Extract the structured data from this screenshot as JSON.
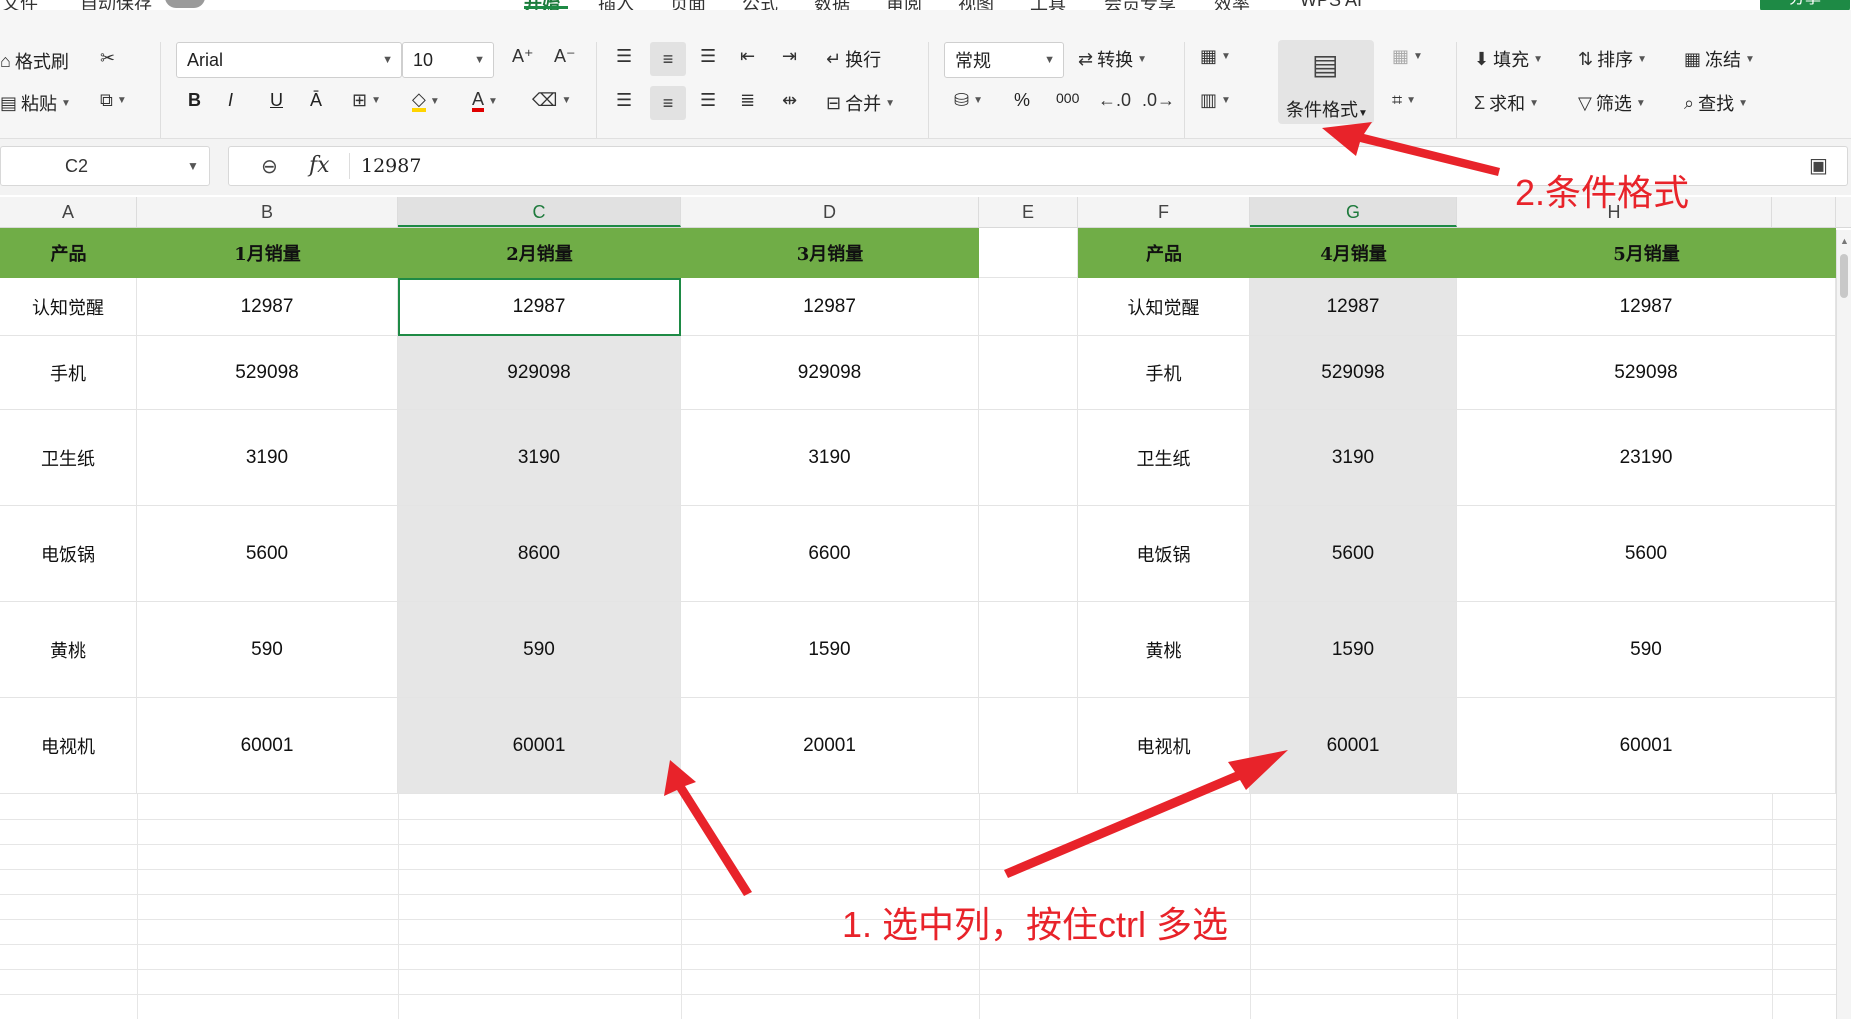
{
  "menu": {
    "items": [
      "文件",
      "自动保存",
      "开始",
      "插入",
      "页面",
      "公式",
      "数据",
      "审阅",
      "视图",
      "工具",
      "会员专享",
      "效率",
      "WPS AI"
    ],
    "active": "开始",
    "share": "分享"
  },
  "ribbon": {
    "format_painter": "格式刷",
    "paste": "粘贴",
    "font_name": "Arial",
    "font_size": "10",
    "bold": "B",
    "italic": "I",
    "underline": "U",
    "strikethrough": "Ā",
    "font_color_letter": "A",
    "wrap": "换行",
    "merge": "合并",
    "number_format": "常规",
    "convert": "转换",
    "percent": "%",
    "thousands": "000",
    "conditional_format": "条件格式",
    "fill": "填充",
    "sort": "排序",
    "freeze": "冻结",
    "sum": "求和",
    "filter": "筛选",
    "find": "查找",
    "colors": {
      "highlight": "#ffd400",
      "font_color": "#e00000"
    }
  },
  "formula_bar": {
    "cell_ref": "C2",
    "fx_label": "fx",
    "value": "12987"
  },
  "columns": [
    "A",
    "B",
    "C",
    "D",
    "E",
    "F",
    "G",
    "H"
  ],
  "table1": {
    "headers": [
      "产品",
      "1月销量",
      "2月销量",
      "3月销量"
    ],
    "rows": [
      [
        "认知觉醒",
        "12987",
        "12987",
        "12987"
      ],
      [
        "手机",
        "529098",
        "929098",
        "929098"
      ],
      [
        "卫生纸",
        "3190",
        "3190",
        "3190"
      ],
      [
        "电饭锅",
        "5600",
        "8600",
        "6600"
      ],
      [
        "黄桃",
        "590",
        "590",
        "1590"
      ],
      [
        "电视机",
        "60001",
        "60001",
        "20001"
      ]
    ]
  },
  "table2": {
    "headers": [
      "产品",
      "4月销量",
      "5月销量"
    ],
    "rows": [
      [
        "认知觉醒",
        "12987",
        "12987"
      ],
      [
        "手机",
        "529098",
        "529098"
      ],
      [
        "卫生纸",
        "3190",
        "23190"
      ],
      [
        "电饭锅",
        "5600",
        "5600"
      ],
      [
        "黄桃",
        "1590",
        "590"
      ],
      [
        "电视机",
        "60001",
        "60001"
      ]
    ]
  },
  "annotations": {
    "step1": "1. 选中列，按住ctrl 多选",
    "step2": "2.条件格式",
    "color": "#e8232a"
  },
  "theme": {
    "header_green": "#70ad47",
    "accent": "#1e8a45",
    "selection_gray": "#e6e6e6"
  }
}
